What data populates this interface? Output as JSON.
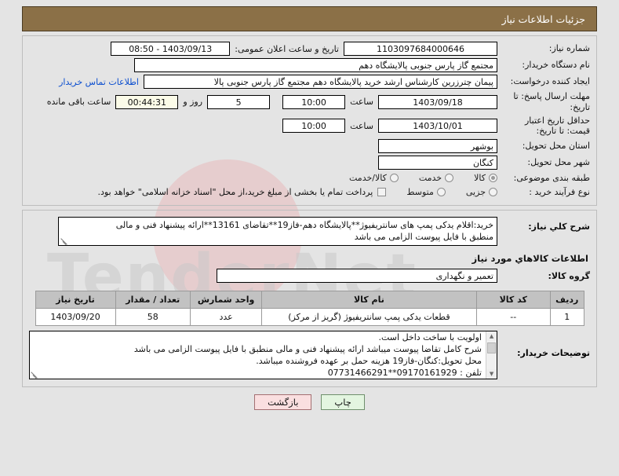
{
  "header": {
    "title": "جزئیات اطلاعات نیاز"
  },
  "colors": {
    "header_bg": "#8b7047",
    "header_text": "#ffffff",
    "page_bg": "#e4e4e4",
    "link": "#0b4ecf",
    "print_btn_bg": "#e3f5e0",
    "back_btn_bg": "#fadfe0",
    "table_header_bg": "#c2c2c2",
    "timer_field_bg": "#fbfbe8"
  },
  "form": {
    "need_number_label": "شماره نیاز:",
    "need_number_value": "1103097684000646",
    "announce_datetime_label": "تاریخ و ساعت اعلان عمومی:",
    "announce_datetime_value": "1403/09/13 - 08:50",
    "buyer_org_label": "نام دستگاه خریدار:",
    "buyer_org_value": "مجتمع گاز پارس جنوبی  پالایشگاه دهم",
    "requester_label": "ایجاد کننده درخواست:",
    "requester_value": "پیمان چترزرین کارشناس ارشد خرید پالایشگاه دهم مجتمع گاز پارس جنوبی  پالا",
    "buyer_contact_link": "اطلاعات تماس خریدار",
    "response_deadline_label": "مهلت ارسال پاسخ: تا تاریخ:",
    "response_deadline_date": "1403/09/18",
    "response_deadline_hour_label": "ساعت",
    "response_deadline_hour": "10:00",
    "remaining_days": "5",
    "remaining_days_label": "روز و",
    "remaining_time": "00:44:31",
    "remaining_time_label": "ساعت باقی مانده",
    "price_validity_label": "حداقل تاریخ اعتبار قیمت: تا تاریخ:",
    "price_validity_date": "1403/10/01",
    "price_validity_hour_label": "ساعت",
    "price_validity_hour": "10:00",
    "province_label": "استان محل تحویل:",
    "province_value": "بوشهر",
    "city_label": "شهر محل تحویل:",
    "city_value": "کنگان",
    "classification_label": "طبقه بندی موضوعی:",
    "classification_options": [
      {
        "label": "کالا",
        "selected": true
      },
      {
        "label": "خدمت",
        "selected": false
      },
      {
        "label": "کالا/خدمت",
        "selected": false
      }
    ],
    "purchase_type_label": "نوع فرآیند خرید :",
    "purchase_type_options": [
      {
        "label": "جزیی",
        "selected": false
      },
      {
        "label": "متوسط",
        "selected": false
      }
    ],
    "treasury_checkbox_checked": false,
    "treasury_note": "پرداخت تمام یا بخشی از مبلغ خرید،از محل \"اسناد خزانه اسلامی\" خواهد بود."
  },
  "description": {
    "label": "شرح کلي نياز:",
    "line1": "خرید:اقلام یدکی پمپ های سانتریفیوژ**پالایشگاه دهم-فاز19**تقاضای 13161**ارائه پیشنهاد فنی و مالی",
    "line2": "منطبق با فایل پیوست الزامی می باشد"
  },
  "goods_section": {
    "section_title": "اطلاعات کالاهاي مورد نياز",
    "group_label": "گروه کالا:",
    "group_value": "تعمیر و نگهداری",
    "table": {
      "headers": [
        "ردیف",
        "کد کالا",
        "نام کالا",
        "واحد شمارش",
        "تعداد / مقدار",
        "تاریخ نیاز"
      ],
      "rows": [
        {
          "row": "1",
          "code": "--",
          "name": "قطعات یدکی پمپ سانتریفیوژ (گریز از مرکز)",
          "unit": "عدد",
          "qty": "58",
          "date": "1403/09/20"
        }
      ]
    }
  },
  "notes": {
    "label": "توضیحات خریدار:",
    "lines": [
      "اولویت با ساخت داخل است.",
      "شرح کامل تقاضا پیوست میباشد ارائه پیشنهاد فنی و مالی منطبق با فایل پیوست الزامی می باشد",
      "محل تحویل:کنگان-فاز19 هزینه حمل بر عهده فروشنده میباشد.",
      "تلفن : 09170161929**07731466291"
    ]
  },
  "buttons": {
    "print": "چاپ",
    "back": "بازگشت"
  },
  "icons": {
    "scroll_up": "▲",
    "scroll_down": "▼"
  },
  "watermark": {
    "text": "TenderNet",
    "text2": "N"
  }
}
